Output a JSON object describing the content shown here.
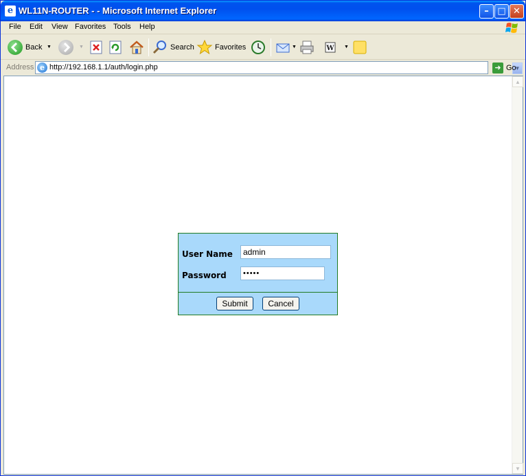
{
  "window": {
    "title": "WL11N-ROUTER - - Microsoft Internet Explorer",
    "minimize_glyph": "–",
    "maximize_glyph": "□",
    "close_glyph": "✕"
  },
  "menu": {
    "items": [
      "File",
      "Edit",
      "View",
      "Favorites",
      "Tools",
      "Help"
    ]
  },
  "toolbar": {
    "back_label": "Back",
    "search_label": "Search",
    "favorites_label": "Favorites"
  },
  "address": {
    "label": "Address",
    "url": "http://192.168.1.1/auth/login.php",
    "go_label": "Go"
  },
  "login": {
    "username_label": "User Name",
    "username_value": "admin",
    "password_label": "Password",
    "password_value": "•••••",
    "submit_label": "Submit",
    "cancel_label": "Cancel"
  },
  "colors": {
    "form_background": "#a9d9fb",
    "form_border": "#1f7a1f",
    "titlebar": "#0053ee"
  }
}
